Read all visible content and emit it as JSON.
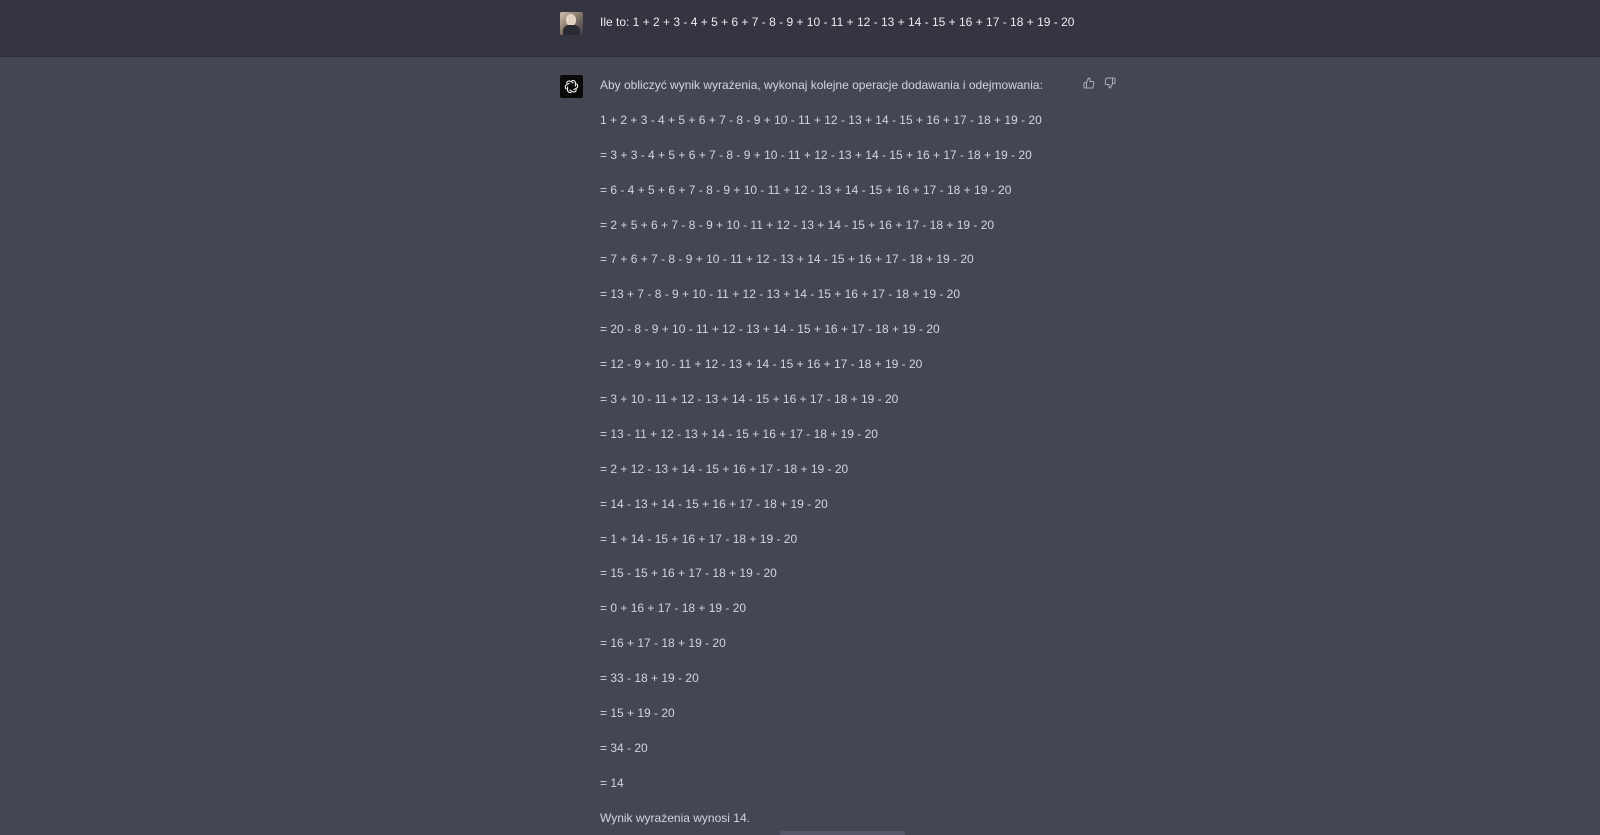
{
  "user_message": {
    "text": "Ile to: 1 + 2 + 3 - 4 + 5 + 6 + 7 - 8 - 9 + 10 - 11 + 12 - 13 + 14 - 15 + 16 + 17 - 18 + 19 - 20"
  },
  "assistant_message": {
    "intro": "Aby obliczyć wynik wyrażenia, wykonaj kolejne operacje dodawania i odejmowania:",
    "steps": [
      "1 + 2 + 3 - 4 + 5 + 6 + 7 - 8 - 9 + 10 - 11 + 12 - 13 + 14 - 15 + 16 + 17 - 18 + 19 - 20",
      "= 3 + 3 - 4 + 5 + 6 + 7 - 8 - 9 + 10 - 11 + 12 - 13 + 14 - 15 + 16 + 17 - 18 + 19 - 20",
      "= 6 - 4 + 5 + 6 + 7 - 8 - 9 + 10 - 11 + 12 - 13 + 14 - 15 + 16 + 17 - 18 + 19 - 20",
      "= 2 + 5 + 6 + 7 - 8 - 9 + 10 - 11 + 12 - 13 + 14 - 15 + 16 + 17 - 18 + 19 - 20",
      "= 7 + 6 + 7 - 8 - 9 + 10 - 11 + 12 - 13 + 14 - 15 + 16 + 17 - 18 + 19 - 20",
      "= 13 + 7 - 8 - 9 + 10 - 11 + 12 - 13 + 14 - 15 + 16 + 17 - 18 + 19 - 20",
      "= 20 - 8 - 9 + 10 - 11 + 12 - 13 + 14 - 15 + 16 + 17 - 18 + 19 - 20",
      "= 12 - 9 + 10 - 11 + 12 - 13 + 14 - 15 + 16 + 17 - 18 + 19 - 20",
      "= 3 + 10 - 11 + 12 - 13 + 14 - 15 + 16 + 17 - 18 + 19 - 20",
      "= 13 - 11 + 12 - 13 + 14 - 15 + 16 + 17 - 18 + 19 - 20",
      "= 2 + 12 - 13 + 14 - 15 + 16 + 17 - 18 + 19 - 20",
      "= 14 - 13 + 14 - 15 + 16 + 17 - 18 + 19 - 20",
      "= 1 + 14 - 15 + 16 + 17 - 18 + 19 - 20",
      "= 15 - 15 + 16 + 17 - 18 + 19 - 20",
      "= 0 + 16 + 17 - 18 + 19 - 20",
      "= 16 + 17 - 18 + 19 - 20",
      "= 33 - 18 + 19 - 20",
      "= 15 + 19 - 20",
      "= 34 - 20",
      "= 14"
    ],
    "conclusion": "Wynik wyrażenia wynosi 14."
  },
  "icons": {
    "user_avatar": "user-avatar",
    "assistant_avatar": "openai-logo-icon",
    "feedback_up": "thumbs-up-icon",
    "feedback_down": "thumbs-down-icon"
  },
  "colors": {
    "user_row_bg": "#343541",
    "assistant_row_bg": "#444654",
    "text": "#d1d5db",
    "user_text": "#ececf1"
  }
}
